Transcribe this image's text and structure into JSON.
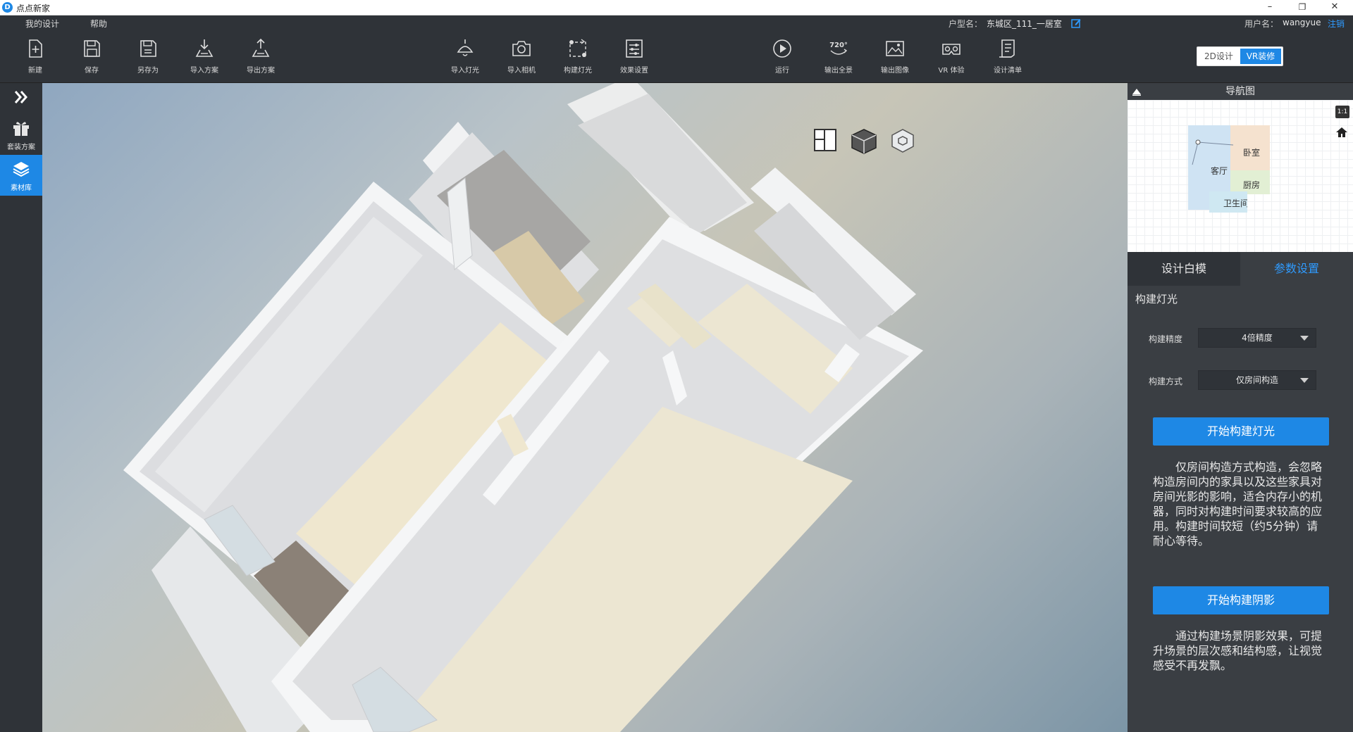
{
  "window": {
    "title": "点点新家",
    "logo_letter": "D",
    "minimize_glyph": "–",
    "restore_glyph": "❐",
    "close_glyph": "✕"
  },
  "menubar": {
    "my_designs": "我的设计",
    "help": "帮助",
    "floorplan_label": "户型名：",
    "floorplan_name": "东城区_111_一居室",
    "user_label": "用户名：",
    "username": "wangyue",
    "logout": "注销"
  },
  "toolbar": {
    "new": "新建",
    "save": "保存",
    "save_as": "另存为",
    "import_plan": "导入方案",
    "export_plan": "导出方案",
    "import_light": "导入灯光",
    "import_camera": "导入相机",
    "build_light": "构建灯光",
    "effect_settings": "效果设置",
    "run": "运行",
    "panorama": "输出全景",
    "panorama_icon_text": "720°",
    "export_image": "输出图像",
    "vr_experience": "VR 体验",
    "design_list": "设计清单",
    "mode_2d": "2D设计",
    "mode_vr": "VR装修"
  },
  "sidebar": {
    "package": "套装方案",
    "library": "素材库"
  },
  "nav": {
    "title": "导航图",
    "one_to_one": "1:1",
    "rooms": {
      "bedroom": "卧室",
      "living": "客厅",
      "kitchen": "厨房",
      "bathroom": "卫生间"
    }
  },
  "tabs": {
    "model": "设计白模",
    "params": "参数设置"
  },
  "panel": {
    "section_title": "构建灯光",
    "precision_label": "构建精度",
    "precision_value": "4倍精度",
    "method_label": "构建方式",
    "method_value": "仅房间构造",
    "build_light_button": "开始构建灯光",
    "light_desc": "仅房间构造方式构造，会忽略构造房间内的家具以及这些家具对房间光影的影响，适合内存小的机器，同时对构建时间要求较高的应用。构建时间较短（约5分钟）请耐心等待。",
    "build_shadow_button": "开始构建阴影",
    "shadow_desc": "通过构建场景阴影效果，可提升场景的层次感和结构感，让视觉感受不再发飘。"
  },
  "colors": {
    "accent": "#1e88e5",
    "link": "#2f9bff",
    "toolbar_bg": "#2f3338",
    "panel_bg": "#3a3e43"
  }
}
